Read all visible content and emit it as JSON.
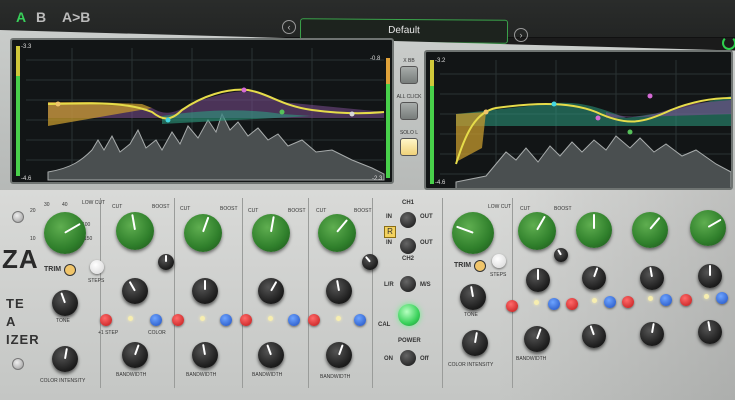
{
  "topbar": {
    "slot_a": "A",
    "slot_b": "B",
    "copy_a_to_b": "A>B",
    "preset_name": "Default",
    "prev_icon": "chevron-left-icon",
    "next_icon": "chevron-right-icon",
    "power_icon": "power-icon",
    "accent_color": "#38d05a"
  },
  "left_screen": {
    "meter_top_left": "-3.3",
    "meter_bottom_left": "-4.6",
    "meter_top_right": "-0.8",
    "meter_bottom_right": "-2.3"
  },
  "right_screen": {
    "meter_top_left": "-3.2",
    "meter_bottom_left": "-4.6"
  },
  "mid_buttons": [
    "X BB",
    "ALL CLICK",
    "SOLO L"
  ],
  "faceplate": {
    "logo_fragment": "ZA",
    "side_text": [
      "TE",
      "A",
      "IZER"
    ],
    "trim_label": "TRIM",
    "steps_label": "STEPS",
    "tone_label": "TONE",
    "color_intensity": "COLOR INTENSITY",
    "bandwidth": "BANDWIDTH",
    "boost": "BOOST",
    "cut": "CUT",
    "color": "COLOR",
    "plus_one_step": "+1 STEP",
    "low_cut": "LOW CUT",
    "ch1": "CH1",
    "ch2": "CH2",
    "in": "IN",
    "out": "OUT",
    "lr": "L/R",
    "ms": "M/S",
    "cal": "CAL",
    "power": "POWER",
    "on": "ON",
    "off": "Off",
    "r_badge": "R",
    "freq_scale": [
      "10",
      "20",
      "30",
      "40",
      "70",
      "100",
      "150",
      "250"
    ]
  }
}
